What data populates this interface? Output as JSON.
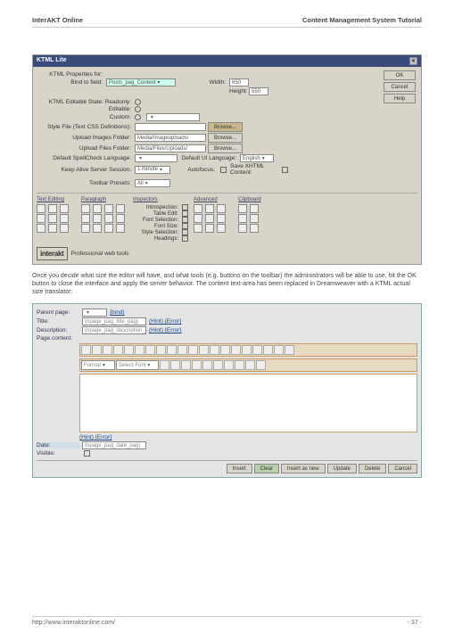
{
  "header": {
    "left": "InterAKT Online",
    "right": "Content Management System Tutorial"
  },
  "dialog1": {
    "title": "KTML Lite",
    "props_label": "KTML Properties for:",
    "bind_label": "Bind to field:",
    "bind_value": "Posts_pag_Content ▾",
    "width_label": "Width:",
    "width_value": "650",
    "height_label": "Height:",
    "height_value": "550",
    "state_label": "KTML Editable State: Readonly:",
    "editable_label": "Editable:",
    "custom_label": "Custom:",
    "style_label": "Style File (Text CSS Definitions):",
    "upimg_label": "Upload Images Folder:",
    "upimg_value": "Media/Imageuploads/",
    "upfile_label": "Upload Files Folder:",
    "upfile_value": "Media/Files/Uploads/",
    "spell_label": "Default SpellCheck Language:",
    "uilang_label": "Default UI Language:",
    "uilang_value": "English",
    "keepalive_label": "Keep Alive Server Session:",
    "keepalive_value": "1 minute",
    "autofocus_label": "Autofocus:",
    "savextml_label": "Save XHTML Content:",
    "presets_label": "Toolbar Presets:",
    "presets_value": "All",
    "browse": "Browse...",
    "buttons": {
      "ok": "OK",
      "cancel": "Cancel",
      "help": "Help"
    },
    "cols": {
      "text": "Text Editing",
      "para": "Paragraph",
      "insp": "Inspectors",
      "adv": "Advanced",
      "clip": "Clipboard",
      "insp_items": [
        "Introspection:",
        "Table Edit:",
        "Font Selection:",
        "Font Size:",
        "Style Selection:",
        "Headings:"
      ]
    },
    "logo": {
      "name": "interakt",
      "tag": "Professional web tools"
    }
  },
  "maintext": "Once you decide what size the editor will have, and what tools (e.g. buttons on the toolbar) the administrators will be able to use, hit the OK button to close the interface and apply the server behavior. The content text-area has been replaced in Dreamweaver with a KTML actual size translator:",
  "editor": {
    "parent": {
      "label": "Parent page:",
      "value": "{bind}"
    },
    "title": {
      "label": "Title:",
      "value": "{npage_pag_title_pag}",
      "hint": "(Hint) {Error}"
    },
    "desc": {
      "label": "Description:",
      "value": "{npage_pag_description_}",
      "hint": "(Hint) {Error}"
    },
    "content_label": "Page content:",
    "format": "Format",
    "font": "Select Font",
    "hint": "(Hint) {Error}",
    "date": {
      "label": "Date:",
      "value": "{npage_pag_date_pag}"
    },
    "visible": {
      "label": "Visible:"
    },
    "buttons": [
      "Insert",
      "Clear",
      "Insert as new",
      "Update",
      "Delete",
      "Cancel"
    ]
  },
  "footer": {
    "url": "http://www.interaktonline.com/",
    "page": "- 37 -"
  }
}
